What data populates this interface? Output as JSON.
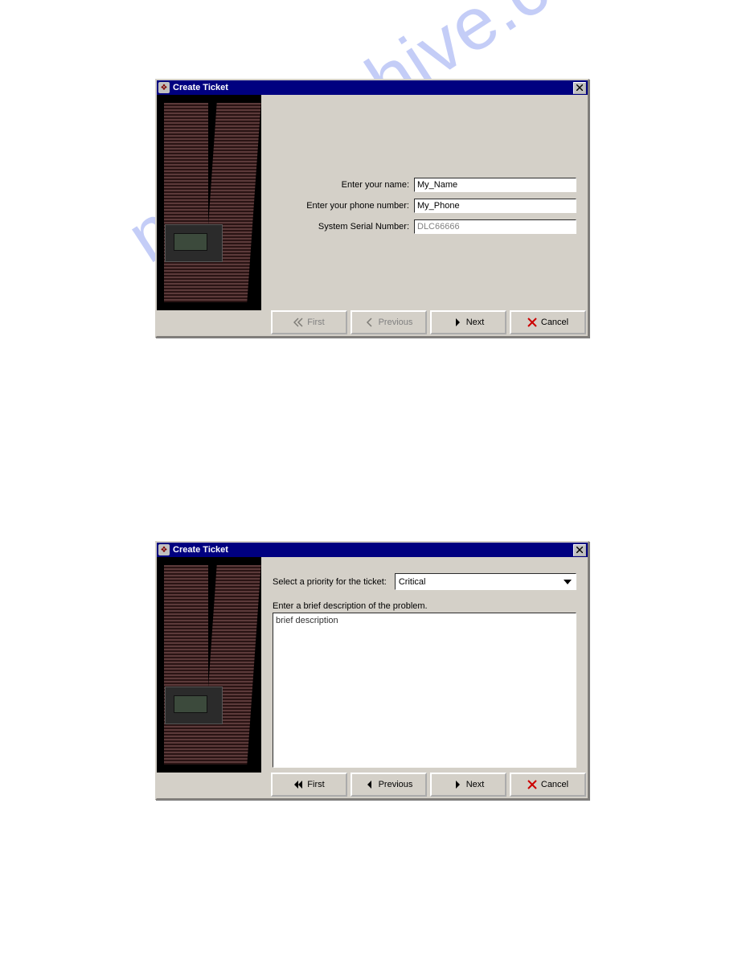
{
  "watermark_text": "manualshive.com",
  "dialog1": {
    "title": "Create Ticket",
    "fields": {
      "name_label": "Enter your name:",
      "name_value": "My_Name",
      "phone_label": "Enter your phone number:",
      "phone_value": "My_Phone",
      "serial_label": "System Serial Number:",
      "serial_value": "DLC66666"
    },
    "buttons": {
      "first": "First",
      "previous": "Previous",
      "next": "Next",
      "cancel": "Cancel"
    }
  },
  "dialog2": {
    "title": "Create Ticket",
    "priority_label": "Select a priority for the ticket:",
    "priority_value": "Critical",
    "description_label": "Enter a brief description of the problem.",
    "description_value": "brief description",
    "buttons": {
      "first": "First",
      "previous": "Previous",
      "next": "Next",
      "cancel": "Cancel"
    }
  }
}
